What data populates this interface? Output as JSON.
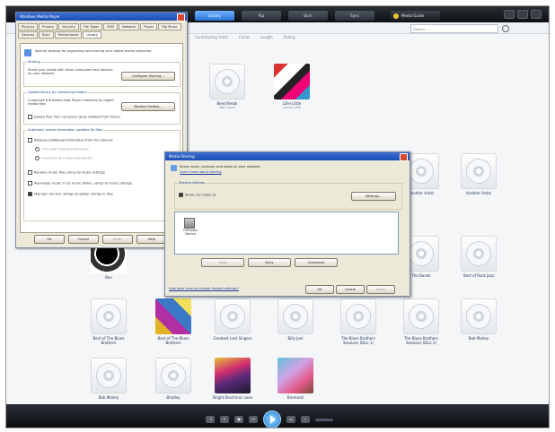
{
  "topbar": {
    "tabs": [
      "Library",
      "Rip",
      "Burn",
      "Sync"
    ],
    "active_tab": "Library",
    "media_guide": "Media Guide"
  },
  "subbar": {
    "search_placeholder": "Search"
  },
  "columns": [
    "Contributing Artist",
    "Count",
    "Length",
    "Rating"
  ],
  "tiles": [
    {
      "label": "Bend Break",
      "sub": "Dan Loud",
      "art": "disc"
    },
    {
      "label": "Lillie Little",
      "sub": "Lorem Liffe",
      "art": "art-a"
    },
    {
      "label": "Another Artist",
      "sub": "",
      "art": "disc"
    },
    {
      "label": "Another Artist",
      "sub": "",
      "art": "disc"
    },
    {
      "label": "Bon",
      "sub": "",
      "art": "art-b"
    },
    {
      "label": "The Bands",
      "sub": "",
      "art": "disc"
    },
    {
      "label": "Best of Rock Jazz",
      "sub": "",
      "art": "disc"
    },
    {
      "label": "Best of The Blues Brothers",
      "sub": "",
      "art": "disc"
    },
    {
      "label": "Best of The Blues Brothers",
      "sub": "",
      "art": "art-c"
    },
    {
      "label": "Greatest Lost Singers",
      "sub": "",
      "art": "disc"
    },
    {
      "label": "Billy Joel",
      "sub": "",
      "art": "disc"
    },
    {
      "label": "The Blues Brothers Sessions (Disc 1)",
      "sub": "",
      "art": "disc"
    },
    {
      "label": "The Blues Brothers Sessions (Disc 2)",
      "sub": "",
      "art": "disc"
    },
    {
      "label": "Bob Marley",
      "sub": "",
      "art": "disc"
    },
    {
      "label": "Bob Marley",
      "sub": "",
      "art": "disc"
    },
    {
      "label": "Bradley",
      "sub": "",
      "art": "disc"
    },
    {
      "label": "Bright Electronic Love",
      "sub": "",
      "art": "art-d"
    },
    {
      "label": "Bromanti",
      "sub": "",
      "art": "art-e"
    }
  ],
  "options_dialog": {
    "title": "Windows Media Player",
    "tabs": [
      "Plug-ins",
      "Privacy",
      "Security",
      "File Types",
      "DVD",
      "Network",
      "Player",
      "Rip Music",
      "Devices",
      "Burn",
      "Performance",
      "Library"
    ],
    "description": "Specify settings for organizing and sharing your digital media collection.",
    "sharing_title": "Sharing",
    "sharing_text": "Share your media with other computers and devices on your network",
    "configure_sharing": "Configure Sharing...",
    "update_title": "Update library by monitoring folders",
    "update_text": "Customize the folders that Player monitors for digital media files",
    "monitor_folders": "Monitor Folders...",
    "delete_files": "Delete files from computer when deleted from library",
    "auto_title": "Automatic media information updates for files",
    "retrieve": "Retrieve additional information from the Internet",
    "only_missing": "Only add missing information",
    "overwrite_all": "Overwrite all media information",
    "rename_files": "Rename music files using rip music settings",
    "rearrange": "Rearrange music in rip music folder, using rip music settings",
    "maintain": "Maintain my star ratings as global ratings in files",
    "buttons": [
      "OK",
      "Cancel",
      "Apply",
      "Help"
    ]
  },
  "share_dialog": {
    "title": "Media Sharing",
    "header": "Share music, pictures, and video on your network.",
    "learn_link": "Learn more about sharing",
    "settings_title": "Sharing settings",
    "share_my_media": "Share my media to:",
    "settings_button": "Settings...",
    "device_label": "Unknown Device",
    "buttons_mid": [
      "Allow",
      "Deny",
      "Customize"
    ],
    "privacy_link": "How does sharing change firewall settings?",
    "buttons_bottom": [
      "OK",
      "Cancel",
      "Apply"
    ]
  }
}
